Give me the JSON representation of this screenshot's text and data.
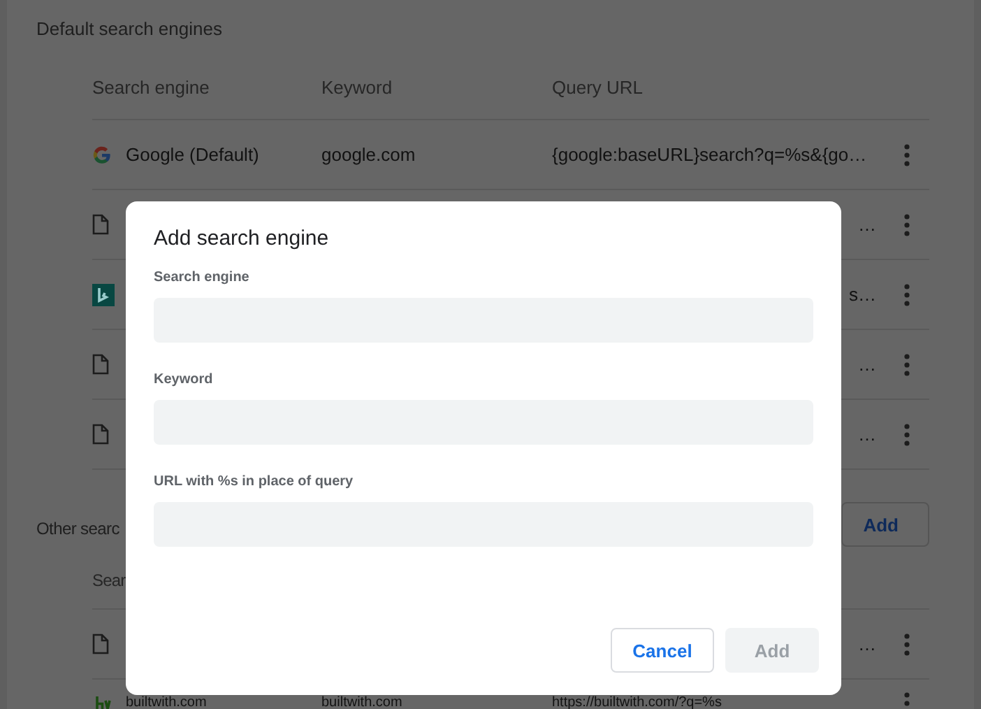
{
  "default_engines": {
    "title": "Default search engines",
    "columns": [
      "Search engine",
      "Keyword",
      "Query URL"
    ],
    "rows": [
      {
        "kind": "google",
        "name": "Google (Default)",
        "keyword": "google.com",
        "url": "{google:baseURL}search?q=%s&{go…"
      },
      {
        "kind": "page",
        "url": "…"
      },
      {
        "kind": "bing",
        "url": "s…"
      },
      {
        "kind": "page",
        "url": "…"
      },
      {
        "kind": "page",
        "url": "…"
      }
    ]
  },
  "other_engines": {
    "title": "Other searc",
    "add_button": "Add",
    "columns": [
      "Sear"
    ],
    "rows": [
      {
        "kind": "page",
        "url": "…"
      },
      {
        "kind": "builtwith",
        "name": "builtwith.com",
        "keyword": "builtwith.com",
        "url": "https://builtwith.com/?q=%s"
      }
    ]
  },
  "dialog": {
    "title": "Add search engine",
    "fields": [
      {
        "label": "Search engine"
      },
      {
        "label": "Keyword"
      },
      {
        "label": "URL with %s in place of query"
      }
    ],
    "buttons": [
      {
        "label": "Cancel",
        "disabled": false
      },
      {
        "label": "Add",
        "disabled": true
      }
    ]
  }
}
